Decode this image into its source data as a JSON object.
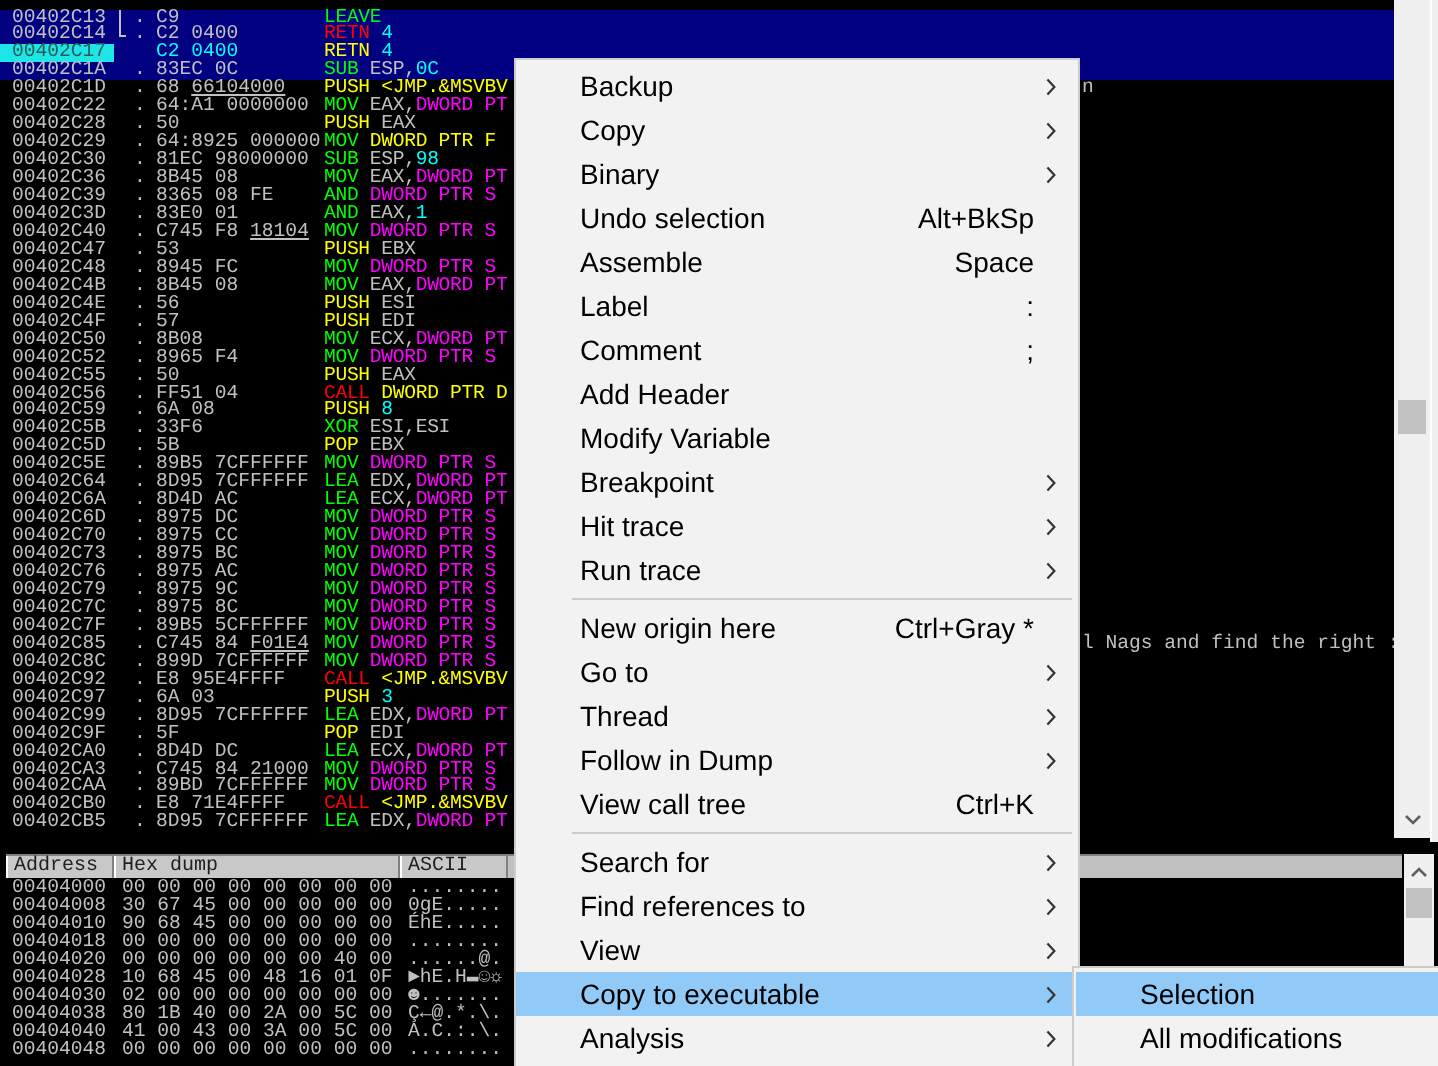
{
  "disassembly": {
    "rows": [
      {
        "address": "00402C13",
        "mark": ".",
        "jump": {
          "kind": "line"
        },
        "hex": "C9",
        "mnemonic": {
          "text": "LEAVE",
          "color": "#00ff00"
        },
        "operands": [],
        "selected": true,
        "current": false
      },
      {
        "address": "00402C14",
        "mark": ".",
        "jump": {
          "kind": "end"
        },
        "hex": "C2 0400",
        "mnemonic": {
          "text": "RETN",
          "color": "#ff0000"
        },
        "operands": [
          {
            "text": "4",
            "color": "#00ffff"
          }
        ],
        "selected": true,
        "current": false
      },
      {
        "address": "00402C17",
        "hex": "C2 0400",
        "mnemonic": {
          "text": "RETN",
          "color": "#ffff00"
        },
        "operands": [
          {
            "text": "4",
            "color": "#00ffff"
          }
        ],
        "selected": true,
        "current": true
      },
      {
        "address": "00402C1A",
        "mark": ".",
        "hex": "83EC 0C",
        "mnemonic": {
          "text": "SUB",
          "color": "#00ff00"
        },
        "operands": [
          {
            "text": "ESP,",
            "color": "#c0c0c0"
          },
          {
            "text": "0C",
            "color": "#00ffff"
          }
        ],
        "selected": true,
        "current": false
      },
      {
        "address": "00402C1D",
        "mark": ".",
        "hex": "68",
        "fixup": "66104000",
        "mnemonic": {
          "text": "PUSH",
          "color": "#ffff00"
        },
        "operands": [
          {
            "text": "<JMP.&MSVBV",
            "color": "#ffff00"
          }
        ],
        "comment": "n",
        "selected": false,
        "current": false
      },
      {
        "address": "00402C22",
        "mark": ".",
        "hex": "64:A1 0000000",
        "mnemonic": {
          "text": "MOV",
          "color": "#00ff00"
        },
        "operands": [
          {
            "text": "EAX,",
            "color": "#c0c0c0"
          },
          {
            "text": "DWORD PT",
            "color": "#ff00ff"
          }
        ],
        "selected": false,
        "current": false
      },
      {
        "address": "00402C28",
        "mark": ".",
        "hex": "50",
        "mnemonic": {
          "text": "PUSH",
          "color": "#ffff00"
        },
        "operands": [
          {
            "text": "EAX",
            "color": "#c0c0c0"
          }
        ],
        "selected": false,
        "current": false
      },
      {
        "address": "00402C29",
        "mark": ".",
        "hex": "64:8925 000000",
        "mnemonic": {
          "text": "MOV",
          "color": "#00ff00"
        },
        "operands": [
          {
            "text": "DWORD PTR F",
            "color": "#ffff00"
          }
        ],
        "selected": false,
        "current": false
      },
      {
        "address": "00402C30",
        "mark": ".",
        "hex": "81EC 98000000",
        "mnemonic": {
          "text": "SUB",
          "color": "#00ff00"
        },
        "operands": [
          {
            "text": "ESP,",
            "color": "#c0c0c0"
          },
          {
            "text": "98",
            "color": "#00ffff"
          }
        ],
        "selected": false,
        "current": false
      },
      {
        "address": "00402C36",
        "mark": ".",
        "hex": "8B45 08",
        "mnemonic": {
          "text": "MOV",
          "color": "#00ff00"
        },
        "operands": [
          {
            "text": "EAX,",
            "color": "#c0c0c0"
          },
          {
            "text": "DWORD PT",
            "color": "#ff00ff"
          }
        ],
        "selected": false,
        "current": false
      },
      {
        "address": "00402C39",
        "mark": ".",
        "hex": "8365 08 FE",
        "mnemonic": {
          "text": "AND",
          "color": "#00ff00"
        },
        "operands": [
          {
            "text": "DWORD PTR S",
            "color": "#ff00ff"
          }
        ],
        "selected": false,
        "current": false
      },
      {
        "address": "00402C3D",
        "mark": ".",
        "hex": "83E0 01",
        "mnemonic": {
          "text": "AND",
          "color": "#00ff00"
        },
        "operands": [
          {
            "text": "EAX,",
            "color": "#c0c0c0"
          },
          {
            "text": "1",
            "color": "#00ffff"
          }
        ],
        "selected": false,
        "current": false
      },
      {
        "address": "00402C40",
        "mark": ".",
        "hex": "C745 F8",
        "fixup": "18104",
        "mnemonic": {
          "text": "MOV",
          "color": "#00ff00"
        },
        "operands": [
          {
            "text": "DWORD PTR S",
            "color": "#ff00ff"
          }
        ],
        "selected": false,
        "current": false
      },
      {
        "address": "00402C47",
        "mark": ".",
        "hex": "53",
        "mnemonic": {
          "text": "PUSH",
          "color": "#ffff00"
        },
        "operands": [
          {
            "text": "EBX",
            "color": "#c0c0c0"
          }
        ],
        "selected": false,
        "current": false
      },
      {
        "address": "00402C48",
        "mark": ".",
        "hex": "8945 FC",
        "mnemonic": {
          "text": "MOV",
          "color": "#00ff00"
        },
        "operands": [
          {
            "text": "DWORD PTR S",
            "color": "#ff00ff"
          }
        ],
        "selected": false,
        "current": false
      },
      {
        "address": "00402C4B",
        "mark": ".",
        "hex": "8B45 08",
        "mnemonic": {
          "text": "MOV",
          "color": "#00ff00"
        },
        "operands": [
          {
            "text": "EAX,",
            "color": "#c0c0c0"
          },
          {
            "text": "DWORD PT",
            "color": "#ff00ff"
          }
        ],
        "selected": false,
        "current": false
      },
      {
        "address": "00402C4E",
        "mark": ".",
        "hex": "56",
        "mnemonic": {
          "text": "PUSH",
          "color": "#ffff00"
        },
        "operands": [
          {
            "text": "ESI",
            "color": "#c0c0c0"
          }
        ],
        "selected": false,
        "current": false
      },
      {
        "address": "00402C4F",
        "mark": ".",
        "hex": "57",
        "mnemonic": {
          "text": "PUSH",
          "color": "#ffff00"
        },
        "operands": [
          {
            "text": "EDI",
            "color": "#c0c0c0"
          }
        ],
        "selected": false,
        "current": false
      },
      {
        "address": "00402C50",
        "mark": ".",
        "hex": "8B08",
        "mnemonic": {
          "text": "MOV",
          "color": "#00ff00"
        },
        "operands": [
          {
            "text": "ECX,",
            "color": "#c0c0c0"
          },
          {
            "text": "DWORD PT",
            "color": "#ff00ff"
          }
        ],
        "selected": false,
        "current": false
      },
      {
        "address": "00402C52",
        "mark": ".",
        "hex": "8965 F4",
        "mnemonic": {
          "text": "MOV",
          "color": "#00ff00"
        },
        "operands": [
          {
            "text": "DWORD PTR S",
            "color": "#ff00ff"
          }
        ],
        "selected": false,
        "current": false
      },
      {
        "address": "00402C55",
        "mark": ".",
        "hex": "50",
        "mnemonic": {
          "text": "PUSH",
          "color": "#ffff00"
        },
        "operands": [
          {
            "text": "EAX",
            "color": "#c0c0c0"
          }
        ],
        "selected": false,
        "current": false
      },
      {
        "address": "00402C56",
        "mark": ".",
        "hex": "FF51 04",
        "mnemonic": {
          "text": "CALL",
          "color": "#ff0000"
        },
        "operands": [
          {
            "text": "DWORD PTR D",
            "color": "#ffff00"
          }
        ],
        "selected": false,
        "current": false
      },
      {
        "address": "00402C59",
        "mark": ".",
        "hex": "6A 08",
        "mnemonic": {
          "text": "PUSH",
          "color": "#ffff00"
        },
        "operands": [
          {
            "text": "8",
            "color": "#00ffff"
          }
        ],
        "selected": false,
        "current": false
      },
      {
        "address": "00402C5B",
        "mark": ".",
        "hex": "33F6",
        "mnemonic": {
          "text": "XOR",
          "color": "#00ff00"
        },
        "operands": [
          {
            "text": "ESI,ESI",
            "color": "#c0c0c0"
          }
        ],
        "selected": false,
        "current": false
      },
      {
        "address": "00402C5D",
        "mark": ".",
        "hex": "5B",
        "mnemonic": {
          "text": "POP",
          "color": "#ffff00"
        },
        "operands": [
          {
            "text": "EBX",
            "color": "#c0c0c0"
          }
        ],
        "selected": false,
        "current": false
      },
      {
        "address": "00402C5E",
        "mark": ".",
        "hex": "89B5 7CFFFFFF",
        "mnemonic": {
          "text": "MOV",
          "color": "#00ff00"
        },
        "operands": [
          {
            "text": "DWORD PTR S",
            "color": "#ff00ff"
          }
        ],
        "selected": false,
        "current": false
      },
      {
        "address": "00402C64",
        "mark": ".",
        "hex": "8D95 7CFFFFFF",
        "mnemonic": {
          "text": "LEA",
          "color": "#00ff00"
        },
        "operands": [
          {
            "text": "EDX,",
            "color": "#c0c0c0"
          },
          {
            "text": "DWORD PT",
            "color": "#ff00ff"
          }
        ],
        "selected": false,
        "current": false
      },
      {
        "address": "00402C6A",
        "mark": ".",
        "hex": "8D4D AC",
        "mnemonic": {
          "text": "LEA",
          "color": "#00ff00"
        },
        "operands": [
          {
            "text": "ECX,",
            "color": "#c0c0c0"
          },
          {
            "text": "DWORD PT",
            "color": "#ff00ff"
          }
        ],
        "selected": false,
        "current": false
      },
      {
        "address": "00402C6D",
        "mark": ".",
        "hex": "8975 DC",
        "mnemonic": {
          "text": "MOV",
          "color": "#00ff00"
        },
        "operands": [
          {
            "text": "DWORD PTR S",
            "color": "#ff00ff"
          }
        ],
        "selected": false,
        "current": false
      },
      {
        "address": "00402C70",
        "mark": ".",
        "hex": "8975 CC",
        "mnemonic": {
          "text": "MOV",
          "color": "#00ff00"
        },
        "operands": [
          {
            "text": "DWORD PTR S",
            "color": "#ff00ff"
          }
        ],
        "selected": false,
        "current": false
      },
      {
        "address": "00402C73",
        "mark": ".",
        "hex": "8975 BC",
        "mnemonic": {
          "text": "MOV",
          "color": "#00ff00"
        },
        "operands": [
          {
            "text": "DWORD PTR S",
            "color": "#ff00ff"
          }
        ],
        "selected": false,
        "current": false
      },
      {
        "address": "00402C76",
        "mark": ".",
        "hex": "8975 AC",
        "mnemonic": {
          "text": "MOV",
          "color": "#00ff00"
        },
        "operands": [
          {
            "text": "DWORD PTR S",
            "color": "#ff00ff"
          }
        ],
        "selected": false,
        "current": false
      },
      {
        "address": "00402C79",
        "mark": ".",
        "hex": "8975 9C",
        "mnemonic": {
          "text": "MOV",
          "color": "#00ff00"
        },
        "operands": [
          {
            "text": "DWORD PTR S",
            "color": "#ff00ff"
          }
        ],
        "selected": false,
        "current": false
      },
      {
        "address": "00402C7C",
        "mark": ".",
        "hex": "8975 8C",
        "mnemonic": {
          "text": "MOV",
          "color": "#00ff00"
        },
        "operands": [
          {
            "text": "DWORD PTR S",
            "color": "#ff00ff"
          }
        ],
        "selected": false,
        "current": false
      },
      {
        "address": "00402C7F",
        "mark": ".",
        "hex": "89B5 5CFFFFFF",
        "mnemonic": {
          "text": "MOV",
          "color": "#00ff00"
        },
        "operands": [
          {
            "text": "DWORD PTR S",
            "color": "#ff00ff"
          }
        ],
        "selected": false,
        "current": false
      },
      {
        "address": "00402C85",
        "mark": ".",
        "hex": "C745 84",
        "fixup": "F01E4",
        "mnemonic": {
          "text": "MOV",
          "color": "#00ff00"
        },
        "operands": [
          {
            "text": "DWORD PTR S",
            "color": "#ff00ff"
          }
        ],
        "comment": "l Nags and find the right :",
        "selected": false,
        "current": false
      },
      {
        "address": "00402C8C",
        "mark": ".",
        "hex": "899D 7CFFFFFF",
        "mnemonic": {
          "text": "MOV",
          "color": "#00ff00"
        },
        "operands": [
          {
            "text": "DWORD PTR S",
            "color": "#ff00ff"
          }
        ],
        "selected": false,
        "current": false
      },
      {
        "address": "00402C92",
        "mark": ".",
        "hex": "E8 95E4FFFF",
        "mnemonic": {
          "text": "CALL",
          "color": "#ff0000"
        },
        "operands": [
          {
            "text": "<JMP.&MSVBV",
            "color": "#ffff00"
          }
        ],
        "selected": false,
        "current": false
      },
      {
        "address": "00402C97",
        "mark": ".",
        "hex": "6A 03",
        "mnemonic": {
          "text": "PUSH",
          "color": "#ffff00"
        },
        "operands": [
          {
            "text": "3",
            "color": "#00ffff"
          }
        ],
        "selected": false,
        "current": false
      },
      {
        "address": "00402C99",
        "mark": ".",
        "hex": "8D95 7CFFFFFF",
        "mnemonic": {
          "text": "LEA",
          "color": "#00ff00"
        },
        "operands": [
          {
            "text": "EDX,",
            "color": "#c0c0c0"
          },
          {
            "text": "DWORD PT",
            "color": "#ff00ff"
          }
        ],
        "selected": false,
        "current": false
      },
      {
        "address": "00402C9F",
        "mark": ".",
        "hex": "5F",
        "mnemonic": {
          "text": "POP",
          "color": "#ffff00"
        },
        "operands": [
          {
            "text": "EDI",
            "color": "#c0c0c0"
          }
        ],
        "selected": false,
        "current": false
      },
      {
        "address": "00402CA0",
        "mark": ".",
        "hex": "8D4D DC",
        "mnemonic": {
          "text": "LEA",
          "color": "#00ff00"
        },
        "operands": [
          {
            "text": "ECX,",
            "color": "#c0c0c0"
          },
          {
            "text": "DWORD PT",
            "color": "#ff00ff"
          }
        ],
        "selected": false,
        "current": false
      },
      {
        "address": "00402CA3",
        "mark": ".",
        "hex": "C745 84 21000",
        "mnemonic": {
          "text": "MOV",
          "color": "#00ff00"
        },
        "operands": [
          {
            "text": "DWORD PTR S",
            "color": "#ff00ff"
          }
        ],
        "selected": false,
        "current": false
      },
      {
        "address": "00402CAA",
        "mark": ".",
        "hex": "89BD 7CFFFFFF",
        "mnemonic": {
          "text": "MOV",
          "color": "#00ff00"
        },
        "operands": [
          {
            "text": "DWORD PTR S",
            "color": "#ff00ff"
          }
        ],
        "selected": false,
        "current": false
      },
      {
        "address": "00402CB0",
        "mark": ".",
        "hex": "E8 71E4FFFF",
        "mnemonic": {
          "text": "CALL",
          "color": "#ff0000"
        },
        "operands": [
          {
            "text": "<JMP.&MSVBV",
            "color": "#ffff00"
          }
        ],
        "selected": false,
        "current": false
      },
      {
        "address": "00402CB5",
        "mark": ".",
        "hex": "8D95 7CFFFFFF",
        "mnemonic": {
          "text": "LEA",
          "color": "#00ff00"
        },
        "operands": [
          {
            "text": "EDX,",
            "color": "#c0c0c0"
          },
          {
            "text": "DWORD PT",
            "color": "#ff00ff"
          }
        ],
        "selected": false,
        "current": false
      }
    ]
  },
  "dump": {
    "columns": [
      "Address",
      "Hex dump",
      "ASCII"
    ],
    "rows": [
      {
        "address": "00404000",
        "bytes": "00 00 00 00 00 00 00 00",
        "ascii": "........"
      },
      {
        "address": "00404008",
        "bytes": "30 67 45 00 00 00 00 00",
        "ascii": "0gE....."
      },
      {
        "address": "00404010",
        "bytes": "90 68 45 00 00 00 00 00",
        "ascii": "ÉhE....."
      },
      {
        "address": "00404018",
        "bytes": "00 00 00 00 00 00 00 00",
        "ascii": "........"
      },
      {
        "address": "00404020",
        "bytes": "00 00 00 00 00 00 40 00",
        "ascii": "......@."
      },
      {
        "address": "00404028",
        "bytes": "10 68 45 00 48 16 01 0F",
        "ascii": "►hE.H▬☺☼"
      },
      {
        "address": "00404030",
        "bytes": "02 00 00 00 00 00 00 00",
        "ascii": "☻......."
      },
      {
        "address": "00404038",
        "bytes": "80 1B 40 00 2A 00 5C 00",
        "ascii": "Ç←@.*.\\."
      },
      {
        "address": "00404040",
        "bytes": "41 00 43 00 3A 00 5C 00",
        "ascii": "A.C.:.\\."
      },
      {
        "address": "00404048",
        "bytes": "00 00 00 00 00 00 00 00",
        "ascii": "........"
      }
    ]
  },
  "context_menu": {
    "items": [
      {
        "kind": "item",
        "label": "Backup",
        "submenu": true,
        "selected": false
      },
      {
        "kind": "item",
        "label": "Copy",
        "submenu": true,
        "selected": false
      },
      {
        "kind": "item",
        "label": "Binary",
        "submenu": true,
        "selected": false
      },
      {
        "kind": "item",
        "label": "Undo selection",
        "shortcut": "Alt+BkSp",
        "submenu": false,
        "selected": false
      },
      {
        "kind": "item",
        "label": "Assemble",
        "shortcut": "Space",
        "submenu": false,
        "selected": false
      },
      {
        "kind": "item",
        "label": "Label",
        "shortcut": ":",
        "submenu": false,
        "selected": false
      },
      {
        "kind": "item",
        "label": "Comment",
        "shortcut": ";",
        "submenu": false,
        "selected": false
      },
      {
        "kind": "item",
        "label": "Add Header",
        "submenu": false,
        "selected": false
      },
      {
        "kind": "item",
        "label": "Modify Variable",
        "submenu": false,
        "selected": false
      },
      {
        "kind": "item",
        "label": "Breakpoint",
        "submenu": true,
        "selected": false
      },
      {
        "kind": "item",
        "label": "Hit trace",
        "submenu": true,
        "selected": false
      },
      {
        "kind": "item",
        "label": "Run trace",
        "submenu": true,
        "selected": false
      },
      {
        "kind": "separator"
      },
      {
        "kind": "item",
        "label": "New origin here",
        "shortcut": "Ctrl+Gray *",
        "submenu": false,
        "selected": false
      },
      {
        "kind": "item",
        "label": "Go to",
        "submenu": true,
        "selected": false
      },
      {
        "kind": "item",
        "label": "Thread",
        "submenu": true,
        "selected": false
      },
      {
        "kind": "item",
        "label": "Follow in Dump",
        "submenu": true,
        "selected": false
      },
      {
        "kind": "item",
        "label": "View call tree",
        "shortcut": "Ctrl+K",
        "submenu": false,
        "selected": false
      },
      {
        "kind": "separator"
      },
      {
        "kind": "item",
        "label": "Search for",
        "submenu": true,
        "selected": false
      },
      {
        "kind": "item",
        "label": "Find references to",
        "submenu": true,
        "selected": false
      },
      {
        "kind": "item",
        "label": "View",
        "submenu": true,
        "selected": false
      },
      {
        "kind": "item",
        "label": "Copy to executable",
        "submenu": true,
        "selected": true
      },
      {
        "kind": "item",
        "label": "Analysis",
        "submenu": true,
        "selected": false
      }
    ]
  },
  "submenu": {
    "items": [
      {
        "label": "Selection",
        "selected": true
      },
      {
        "label": "All modifications",
        "selected": false
      }
    ]
  }
}
